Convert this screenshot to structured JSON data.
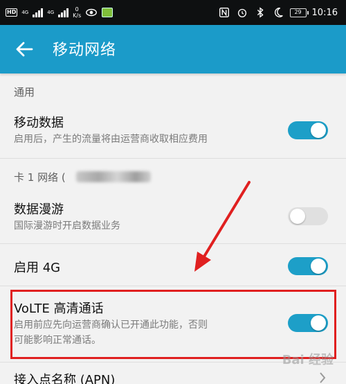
{
  "status_bar": {
    "hd": "HD",
    "net1": "4G",
    "net2": "4G",
    "speed_value": "0",
    "speed_unit": "K/s",
    "battery": "29",
    "time": "10:16"
  },
  "app_bar": {
    "title": "移动网络"
  },
  "sections": {
    "general": "通用",
    "card1": "卡 1 网络 ("
  },
  "rows": {
    "mobile_data": {
      "title": "移动数据",
      "subtitle": "启用后，产生的流量将由运营商收取相应费用",
      "enabled": true
    },
    "data_roaming": {
      "title": "数据漫游",
      "subtitle": "国际漫游时开启数据业务",
      "enabled": false
    },
    "enable_4g": {
      "title": "启用 4G",
      "enabled": true
    },
    "volte": {
      "title": "VoLTE 高清通话",
      "subtitle_line1": "启用前应先向运营商确认已开通此功能，否则",
      "subtitle_line2": "可能影响正常通话。",
      "enabled": true
    },
    "apn": {
      "title": "接入点名称 (APN)"
    }
  },
  "watermark": "Bai 经验",
  "colors": {
    "accent": "#1b9bc9",
    "toggle_on": "#1d9fc8",
    "annotation": "#e02020"
  }
}
